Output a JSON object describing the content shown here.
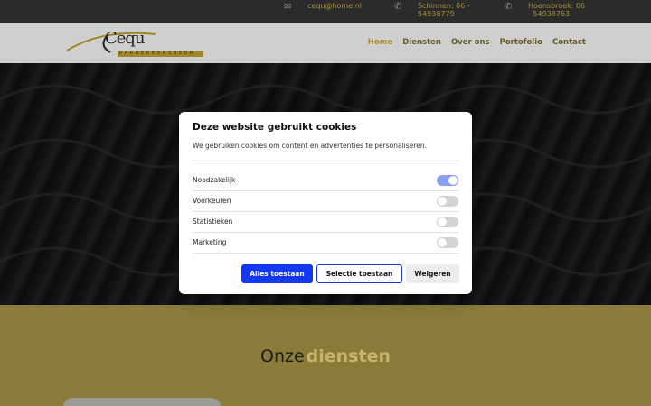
{
  "topbar": {
    "email": "cequ@home.nl",
    "phone1": "Schinnen: 06 - 54938779",
    "phone2": "Hoensbroek: 06 - 54938763"
  },
  "header": {
    "logo_text": "Cequ",
    "logo_sub": "DAKDEKKERSBEDR",
    "nav": [
      "Home",
      "Diensten",
      "Over ons",
      "Portofolio",
      "Contact"
    ],
    "active": "Home"
  },
  "cookie": {
    "title": "Deze website gebruikt cookies",
    "description": "We gebruiken cookies om content en advertenties te personaliseren.",
    "rows": [
      {
        "label": "Noodzakelijk",
        "enabled": true
      },
      {
        "label": "Voorkeuren",
        "enabled": false
      },
      {
        "label": "Statistieken",
        "enabled": false
      },
      {
        "label": "Marketing",
        "enabled": false
      }
    ],
    "buttons": {
      "accept_all": "Alles toestaan",
      "accept_selection": "Selectie toestaan",
      "deny": "Weigeren"
    }
  },
  "section": {
    "title_a": "Onze",
    "title_b": "diensten"
  },
  "colors": {
    "accent_gold": "#b08e2c",
    "primary_blue": "#1438f0",
    "toggle_on": "#8a9ef3",
    "gold_bg": "#8a7b3a"
  }
}
